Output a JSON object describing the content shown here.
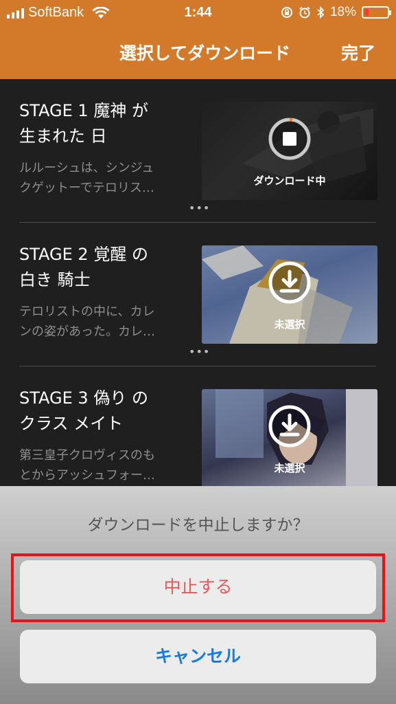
{
  "status_bar": {
    "carrier": "SoftBank",
    "time": "1:44",
    "battery": "18%",
    "battery_level": 0.18
  },
  "nav": {
    "title": "選択してダウンロード",
    "done_label": "完了"
  },
  "episodes": [
    {
      "title_line1": "STAGE 1 魔神 が",
      "title_line2": "生まれた 日",
      "desc_line1": "ルルーシュは、シンジュ",
      "desc_line2": "クゲットーでテロリス…",
      "status": "ダウンロード中",
      "icon": "stop-icon"
    },
    {
      "title_line1": "STAGE 2 覚醒 の",
      "title_line2": "白き 騎士",
      "desc_line1": "テロリストの中に、カレ",
      "desc_line2": "ンの姿があった。カレ…",
      "status": "未選択",
      "icon": "download-icon"
    },
    {
      "title_line1": "STAGE 3 偽り の",
      "title_line2": "クラス メイト",
      "desc_line1": "第三皇子クロヴィスのも",
      "desc_line2": "とからアッシュフォー…",
      "status": "未選択",
      "icon": "download-icon"
    }
  ],
  "more_label": "•••",
  "action_sheet": {
    "message": "ダウンロードを中止しますか？",
    "stop_label": "中止する",
    "cancel_label": "キャンセル"
  },
  "colors": {
    "header": "#d37a2a",
    "destructive": "#e85a5a",
    "cancel": "#1a7ae0",
    "highlight": "#e8131a"
  }
}
